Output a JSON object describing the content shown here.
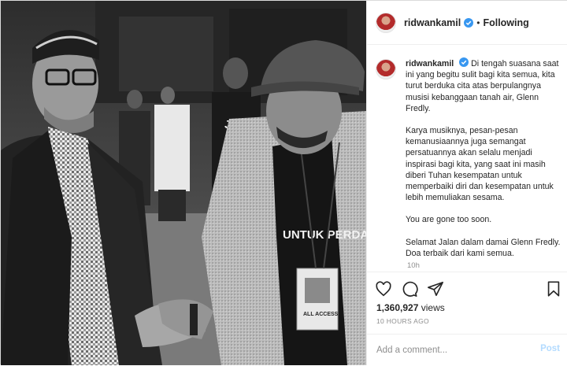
{
  "post": {
    "photo_badge_text": "UNTUK PERDAMAIAN",
    "photo_jacket_text": "JAZZ",
    "photo_pass_text": "ALL ACCESS"
  },
  "header": {
    "username": "ridwankamil",
    "separator": "•",
    "follow_status": "Following",
    "verified_icon": "verified-badge-icon"
  },
  "caption": {
    "username": "ridwankamil",
    "paragraphs": [
      "Di tengah suasana saat ini yang begitu sulit bagi kita semua, kita turut berduka cita atas berpulangnya musisi kebanggaan tanah air, Glenn Fredly.",
      "Karya musiknya, pesan-pesan kemanusiaannya juga semangat persatuannya akan selalu menjadi inspirasi bagi kita, yang saat ini masih diberi Tuhan kesempatan untuk memperbaiki diri dan kesempatan untuk lebih memuliakan sesama.",
      "You are gone too soon.",
      "Selamat Jalan dalam damai Glenn Fredly. Doa terbaik dari kami semua."
    ],
    "relative_time": "10h"
  },
  "actions": {
    "like_icon": "heart-icon",
    "comment_icon": "comment-icon",
    "share_icon": "paper-plane-icon",
    "save_icon": "bookmark-icon",
    "views_count": "1,360,927",
    "views_label": "views",
    "time_ago": "10 HOURS AGO"
  },
  "comment": {
    "placeholder": "Add a comment...",
    "post_label": "Post"
  },
  "colors": {
    "verified_blue": "#3897f0",
    "post_button_disabled": "#b3dbff",
    "muted_text": "#8e8e8e"
  }
}
